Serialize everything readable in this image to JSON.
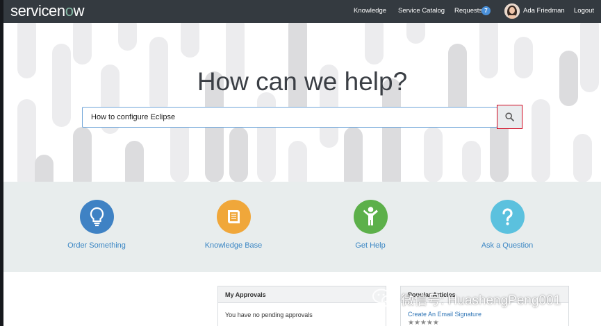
{
  "brand": {
    "logo_service": "service",
    "logo_n": "n",
    "logo_o": "o",
    "logo_w": "w"
  },
  "nav": {
    "knowledge": "Knowledge",
    "service_catalog": "Service Catalog",
    "requests": "Requests",
    "requests_count": "7",
    "user_name": "Ada Friedman",
    "logout": "Logout"
  },
  "hero": {
    "title": "How can we help?",
    "search_value": "How to configure Eclipse"
  },
  "actions": [
    {
      "label": "Order Something",
      "icon": "lightbulb-icon",
      "color": "#3f82c4"
    },
    {
      "label": "Knowledge Base",
      "icon": "book-icon",
      "color": "#f0a73a"
    },
    {
      "label": "Get Help",
      "icon": "person-help-icon",
      "color": "#5cb04a"
    },
    {
      "label": "Ask a Question",
      "icon": "question-icon",
      "color": "#5bc1de"
    }
  ],
  "approvals": {
    "title": "My Approvals",
    "empty_text": "You have no pending approvals"
  },
  "popular": {
    "title": "Popular Articles",
    "link": "Create An Email Signature",
    "rating": "★★★★★"
  },
  "watermark": {
    "text": "微信号: HuashengPeng001"
  },
  "colors": {
    "topnav": "#343a40",
    "accent": "#3a86c4",
    "search_border": "#d0021b"
  }
}
